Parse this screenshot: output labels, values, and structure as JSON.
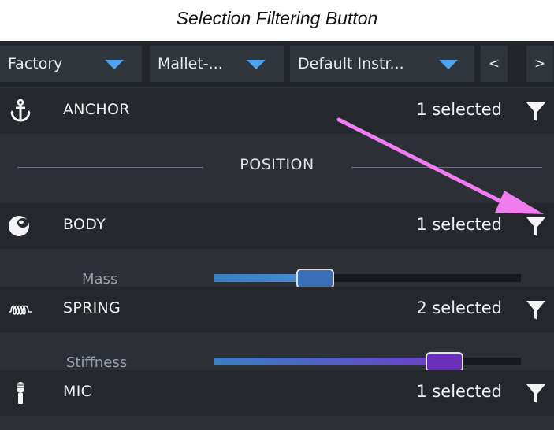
{
  "caption": "Selection Filtering Button",
  "toolbar": {
    "dropdowns": [
      {
        "label": "Factory"
      },
      {
        "label": "Mallet-..."
      },
      {
        "label": "Default Instr..."
      }
    ],
    "prev_label": "<",
    "next_label": ">"
  },
  "sections": {
    "anchor": {
      "label": "ANCHOR",
      "count": "1 selected",
      "icon": "anchor-icon"
    },
    "position": {
      "title": "POSITION"
    },
    "body": {
      "label": "BODY",
      "count": "1 selected",
      "icon": "body-ball-icon"
    },
    "mass": {
      "label": "Mass",
      "level": 0.33
    },
    "spring": {
      "label": "SPRING",
      "count": "2 selected",
      "icon": "spring-coil-icon"
    },
    "stiffness": {
      "label": "Stiffness",
      "level": 0.75
    },
    "mic": {
      "label": "MIC",
      "count": "1 selected",
      "icon": "microphone-icon"
    }
  },
  "colors": {
    "accent": "#4da3f0",
    "annotation_arrow": "#f07cf0",
    "panel_bg": "#2c3036",
    "row_bg": "#24282d"
  }
}
